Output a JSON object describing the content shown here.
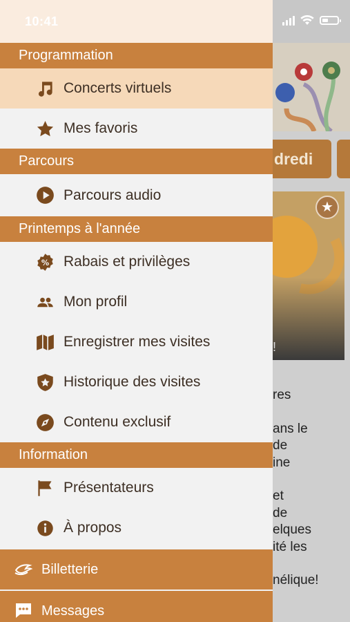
{
  "status_bar": {
    "time": "10:41"
  },
  "background": {
    "day_tab": "dredi",
    "card_fragment": "!",
    "blurb_lines": [
      "res",
      "ans le\nde\nine",
      "et\nde\nelques\nité les",
      "nélique!"
    ]
  },
  "menu": {
    "sections": [
      {
        "title": "Programmation",
        "items": [
          {
            "label": "Concerts virtuels",
            "icon": "music-note-icon",
            "active": true
          },
          {
            "label": "Mes favoris",
            "icon": "star-icon",
            "active": false
          }
        ]
      },
      {
        "title": "Parcours",
        "items": [
          {
            "label": "Parcours audio",
            "icon": "play-circle-icon",
            "active": false
          }
        ]
      },
      {
        "title": "Printemps à l'année",
        "items": [
          {
            "label": "Rabais et privilèges",
            "icon": "percent-badge-icon",
            "active": false
          },
          {
            "label": "Mon profil",
            "icon": "people-icon",
            "active": false
          },
          {
            "label": "Enregistrer mes visites",
            "icon": "map-icon",
            "active": false
          },
          {
            "label": "Historique des visites",
            "icon": "shield-star-icon",
            "active": false
          },
          {
            "label": "Contenu exclusif",
            "icon": "compass-icon",
            "active": false
          }
        ]
      },
      {
        "title": "Information",
        "items": [
          {
            "label": "Présentateurs",
            "icon": "flag-icon",
            "active": false
          },
          {
            "label": "À propos",
            "icon": "info-icon",
            "active": false
          }
        ]
      }
    ],
    "footer": [
      {
        "label": "Billetterie",
        "icon": "ticket-icon"
      },
      {
        "label": "Messages",
        "icon": "chat-icon"
      }
    ]
  },
  "colors": {
    "section_bg": "#c8813e",
    "active_bg": "#f6d9b9",
    "icon": "#7a4a1e",
    "menu_bg": "#f2f2f2"
  }
}
